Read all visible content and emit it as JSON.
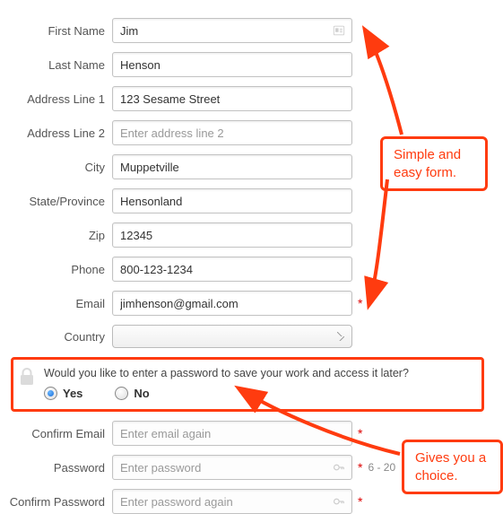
{
  "form": {
    "first_name": {
      "label": "First Name",
      "value": "Jim"
    },
    "last_name": {
      "label": "Last Name",
      "value": "Henson"
    },
    "address1": {
      "label": "Address Line 1",
      "value": "123 Sesame Street"
    },
    "address2": {
      "label": "Address Line 2",
      "placeholder": "Enter address line 2",
      "value": ""
    },
    "city": {
      "label": "City",
      "value": "Muppetville"
    },
    "state": {
      "label": "State/Province",
      "value": "Hensonland"
    },
    "zip": {
      "label": "Zip",
      "value": "12345"
    },
    "phone": {
      "label": "Phone",
      "value": "800-123-1234"
    },
    "email": {
      "label": "Email",
      "value": "jimhenson@gmail.com",
      "required_mark": "*"
    },
    "country": {
      "label": "Country",
      "value": ""
    },
    "confirm_email": {
      "label": "Confirm Email",
      "placeholder": "Enter email again",
      "required_mark": "*"
    },
    "password": {
      "label": "Password",
      "placeholder": "Enter password",
      "required_mark": "*",
      "hint": "6 - 20"
    },
    "confirm_password": {
      "label": "Confirm Password",
      "placeholder": "Enter password again",
      "required_mark": "*"
    }
  },
  "password_section": {
    "prompt": "Would you like to enter a password to save your work and access it later?",
    "options": {
      "yes": "Yes",
      "no": "No"
    },
    "selected": "yes"
  },
  "callouts": {
    "simple": "Simple and easy form.",
    "choice": "Gives you a choice."
  }
}
